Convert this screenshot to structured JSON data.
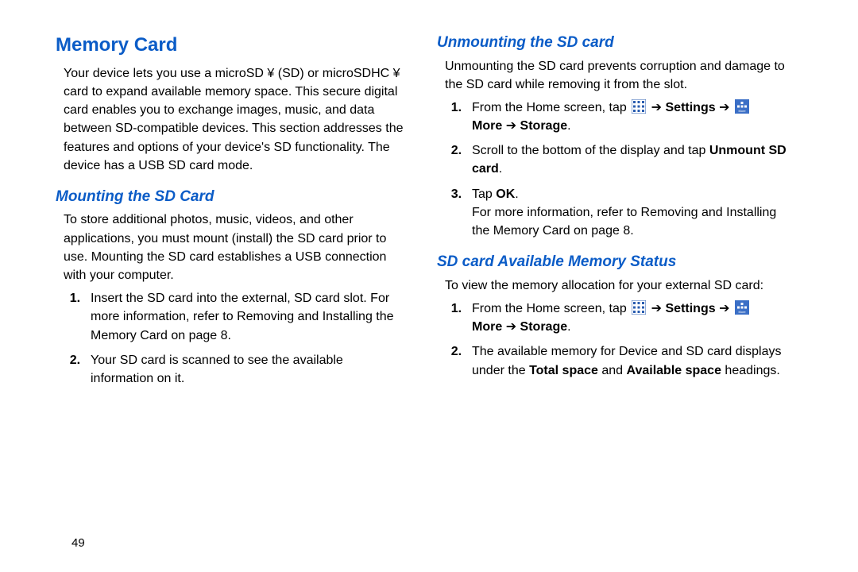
{
  "pageNumber": "49",
  "left": {
    "h1": "Memory Card",
    "intro": "Your device lets you use a microSD ¥ (SD) or microSDHC ¥ card to expand available memory space. This secure digital card enables you to exchange images, music, and data between SD-compatible devices. This section addresses the features and options of your device's SD functionality. The device has a USB SD card mode.",
    "h2": "Mounting the SD Card",
    "p2": "To store additional photos, music, videos, and other applications, you must mount (install) the SD card prior to use. Mounting the SD card establishes a USB connection with your computer.",
    "steps": [
      {
        "pre": "Insert the SD card into the external, SD card slot. For more information, refer to ",
        "ref": " Removing and Installing the Memory Card",
        "post": " on page 8."
      },
      {
        "text": "Your SD card is scanned to see the available information on it."
      }
    ]
  },
  "right": {
    "h2a": "Unmounting the SD card",
    "pa": "Unmounting the SD card prevents corruption and damage to the SD card while removing it from the slot.",
    "stepsA": {
      "s1_pre": "From the Home screen, tap ",
      "s1_settings": "Settings",
      "s1_arrow": " ➔ ",
      "s1_more": "More",
      "s1_storage": "Storage",
      "s2_pre": "Scroll to the bottom of the display and tap ",
      "s2_bold": "Unmount SD card",
      "s2_post": ".",
      "s3_pre": "Tap ",
      "s3_ok": "OK",
      "s3_post": ".",
      "s3_ref_pre": "For more information, refer to ",
      "s3_ref": " Removing and Installing the Memory Card",
      "s3_ref_post": " on page 8."
    },
    "h2b": "SD card Available Memory Status",
    "pb": "To view the memory allocation for your external SD card:",
    "stepsB": {
      "s1_pre": "From the Home screen, tap ",
      "s1_settings": "Settings",
      "s1_arrow": " ➔ ",
      "s1_more": "More",
      "s1_storage": "Storage",
      "s2_pre": "The available memory for Device and SD card displays under the ",
      "s2_b1": "Total space",
      "s2_mid": " and ",
      "s2_b2": "Available space",
      "s2_post": " headings."
    }
  }
}
